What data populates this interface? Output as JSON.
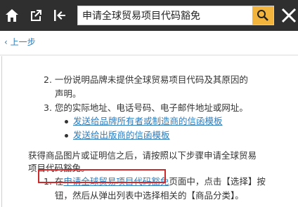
{
  "toolbar": {
    "search_value": "申请全球贸易项目代码豁免"
  },
  "nav": {
    "back_label": "上一步"
  },
  "article": {
    "item2_line1": "2. 一份说明品牌未提供全球贸易项目代码及其原因的",
    "item2_line2": "声明。",
    "item3": "3. 您的实际地址、电话号码、电子邮件地址或网址。",
    "link_brand_owner": "发送给品牌所有者或制造商的信函模板",
    "link_seller": "发送给出版商的信函模板",
    "para_line1": "获得商品图片或证明信之后，请按照以下步骤申请全球贸易",
    "para_line2": "项目代码豁免。",
    "step1_num": "1. 在",
    "step1_link": "申请全球贸易项目代码豁免",
    "step1_rest": "页面中，点击【选择】按",
    "step1_line2": "钮，然后从弹出列表中选择相关的【商品分类】。"
  }
}
